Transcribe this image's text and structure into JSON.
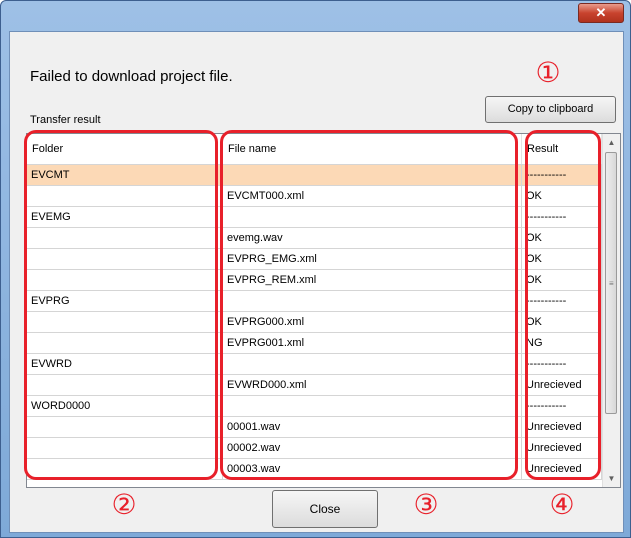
{
  "window": {
    "close_glyph": "✕"
  },
  "message": "Failed to download project file.",
  "section_label": "Transfer result",
  "copy_button_label": "Copy to clipboard",
  "table": {
    "columns": [
      "Folder",
      "File name",
      "Result"
    ],
    "rows": [
      {
        "folder": "EVCMT",
        "file": "",
        "result": "-----------",
        "selected": true
      },
      {
        "folder": "",
        "file": "EVCMT000.xml",
        "result": "OK"
      },
      {
        "folder": "EVEMG",
        "file": "",
        "result": "-----------"
      },
      {
        "folder": "",
        "file": "evemg.wav",
        "result": "OK"
      },
      {
        "folder": "",
        "file": "EVPRG_EMG.xml",
        "result": "OK"
      },
      {
        "folder": "",
        "file": "EVPRG_REM.xml",
        "result": "OK"
      },
      {
        "folder": "EVPRG",
        "file": "",
        "result": "-----------"
      },
      {
        "folder": "",
        "file": "EVPRG000.xml",
        "result": "OK"
      },
      {
        "folder": "",
        "file": "EVPRG001.xml",
        "result": "NG"
      },
      {
        "folder": "EVWRD",
        "file": "",
        "result": "-----------"
      },
      {
        "folder": "",
        "file": "EVWRD000.xml",
        "result": "Unrecieved"
      },
      {
        "folder": "WORD0000",
        "file": "",
        "result": "-----------"
      },
      {
        "folder": "",
        "file": "00001.wav",
        "result": "Unrecieved"
      },
      {
        "folder": "",
        "file": "00002.wav",
        "result": "Unrecieved"
      },
      {
        "folder": "",
        "file": "00003.wav",
        "result": "Unrecieved"
      }
    ]
  },
  "close_button_label": "Close",
  "callouts": {
    "n1": "①",
    "n2": "②",
    "n3": "③",
    "n4": "④"
  },
  "colors": {
    "callout": "#e8202a",
    "selected_row": "#fcd9b6"
  }
}
